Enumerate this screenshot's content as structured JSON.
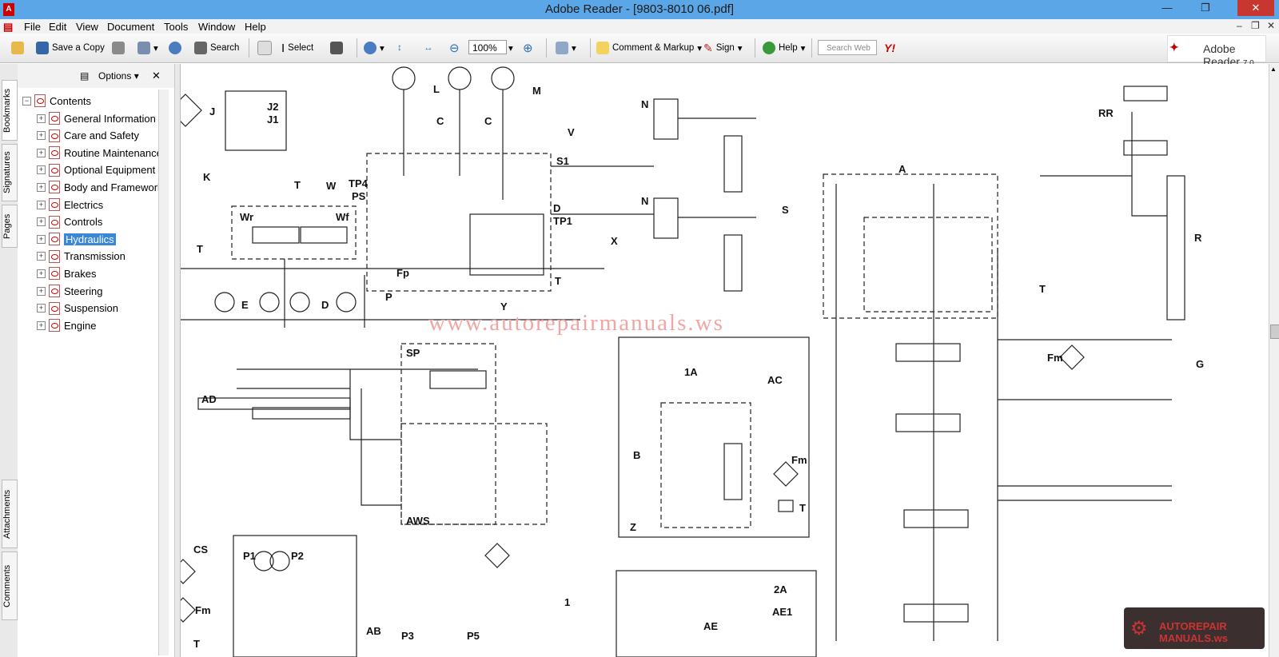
{
  "window": {
    "title": "Adobe Reader - [9803-8010 06.pdf]"
  },
  "menu": {
    "items": [
      "File",
      "Edit",
      "View",
      "Document",
      "Tools",
      "Window",
      "Help"
    ]
  },
  "toolbar": {
    "save_copy": "Save a Copy",
    "search": "Search",
    "select": "Select",
    "zoom": "100%",
    "comment": "Comment & Markup",
    "sign": "Sign",
    "help": "Help",
    "search_web_placeholder": "Search Web",
    "yahoo": "Y!"
  },
  "brand": {
    "name": "Adobe Reader",
    "version": "7.0"
  },
  "sidetabs": [
    "Bookmarks",
    "Signatures",
    "Pages",
    "Attachments",
    "Comments"
  ],
  "panel": {
    "options": "Options",
    "root": "Contents",
    "items": [
      "General Information",
      "Care and Safety",
      "Routine Maintenance",
      "Optional Equipment",
      "Body and Framework",
      "Electrics",
      "Controls",
      "Hydraulics",
      "Transmission",
      "Brakes",
      "Steering",
      "Suspension",
      "Engine"
    ],
    "selected": "Hydraulics"
  },
  "document": {
    "watermark": "www.autorepairmanuals.ws",
    "brand_watermark": "AUTOREPAIR MANUALS.ws",
    "labels": [
      "L",
      "M",
      "C",
      "C",
      "V",
      "J",
      "J2",
      "J1",
      "K",
      "N",
      "N",
      "T",
      "T",
      "W",
      "Wr",
      "Wf",
      "TP4",
      "PS",
      "S1",
      "D",
      "TP1",
      "X",
      "S",
      "Fp",
      "P",
      "T",
      "Y",
      "E",
      "D",
      "RR",
      "A",
      "R",
      "T",
      "AD",
      "SP",
      "AWS",
      "1A",
      "AC",
      "B",
      "Fm",
      "T",
      "Z",
      "Fm",
      "G",
      "CS",
      "P1",
      "P2",
      "Fm",
      "AB",
      "1",
      "AE",
      "2A",
      "AE1",
      "P3",
      "P5",
      "T"
    ]
  },
  "colors": {
    "titlebar": "#5aa6e6",
    "selection": "#3a87d9",
    "close": "#c7372f",
    "watermark": "#f1a5a5"
  }
}
